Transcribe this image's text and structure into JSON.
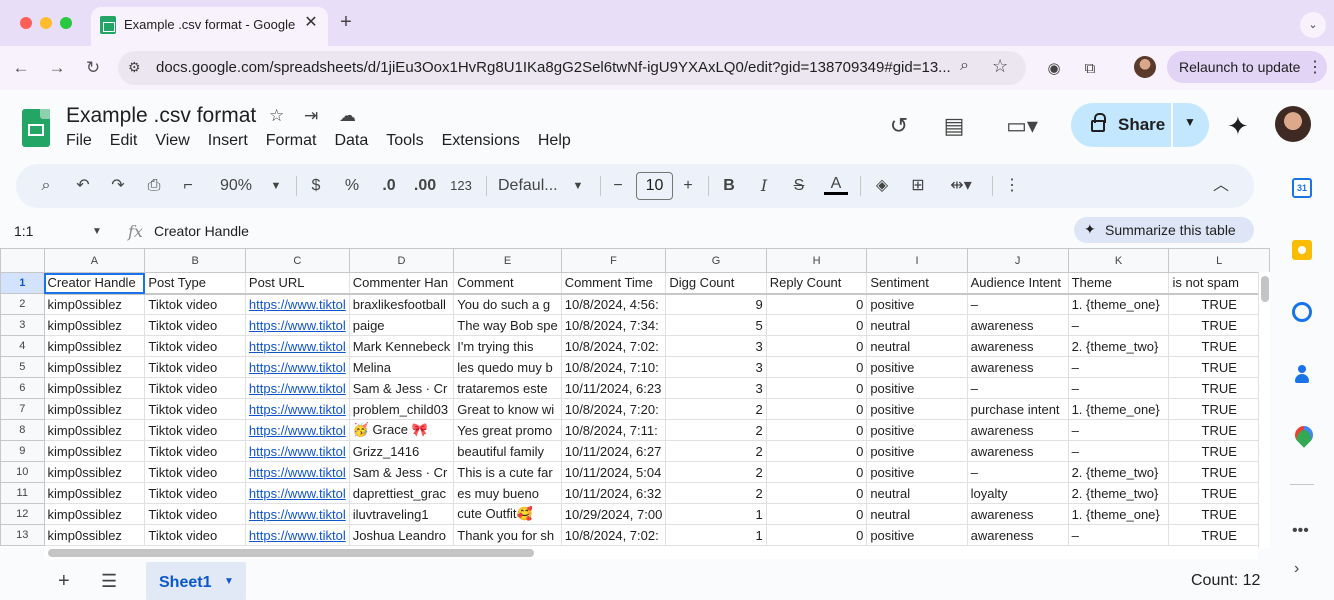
{
  "browser": {
    "tab_title": "Example .csv format - Google",
    "url": "docs.google.com/spreadsheets/d/1jiEu3Oox1HvRg8U1IKa8gG2Sel6twNf-igU9YXAxLQ0/edit?gid=138709349#gid=13...",
    "relaunch_label": "Relaunch to update"
  },
  "doc": {
    "title": "Example .csv format",
    "menu": [
      "File",
      "Edit",
      "View",
      "Insert",
      "Format",
      "Data",
      "Tools",
      "Extensions",
      "Help"
    ],
    "share_label": "Share"
  },
  "toolbar": {
    "zoom": "90%",
    "currency": "$",
    "percent": "%",
    "dec_decrease": ".0",
    "dec_increase": ".00",
    "number_format": "123",
    "font": "Defaul...",
    "font_size": "10"
  },
  "formula_bar": {
    "cell_ref": "1:1",
    "content": "Creator Handle",
    "summarize_label": "Summarize this table"
  },
  "grid": {
    "columns": [
      "A",
      "B",
      "C",
      "D",
      "E",
      "F",
      "G",
      "H",
      "I",
      "J",
      "K",
      "L"
    ],
    "row_numbers": [
      "1",
      "2",
      "3",
      "4",
      "5",
      "6",
      "7",
      "8",
      "9",
      "10",
      "11",
      "12",
      "13"
    ],
    "header": [
      "Creator Handle",
      "Post Type",
      "Post URL",
      "Commenter Han",
      "Comment",
      "Comment Time",
      "Digg Count",
      "Reply Count",
      "Sentiment",
      "Audience Intent",
      "Theme",
      "is not spam"
    ],
    "rows": [
      [
        "kimp0ssiblez",
        "Tiktok video",
        "https://www.tiktol",
        "braxlikesfootball",
        "You do such a g",
        "10/8/2024, 4:56:",
        "9",
        "0",
        "positive",
        "–",
        "1. {theme_one}",
        "TRUE"
      ],
      [
        "kimp0ssiblez",
        "Tiktok video",
        "https://www.tiktol",
        "paige",
        "The way Bob spe",
        "10/8/2024, 7:34:",
        "5",
        "0",
        "neutral",
        "awareness",
        "–",
        "TRUE"
      ],
      [
        "kimp0ssiblez",
        "Tiktok video",
        "https://www.tiktol",
        "Mark Kennebeck",
        "I'm trying this",
        "10/8/2024, 7:02:",
        "3",
        "0",
        "neutral",
        "awareness",
        "2. {theme_two}",
        "TRUE"
      ],
      [
        "kimp0ssiblez",
        "Tiktok video",
        "https://www.tiktol",
        "Melina",
        "les quedo muy b",
        "10/8/2024, 7:10:",
        "3",
        "0",
        "positive",
        "awareness",
        "–",
        "TRUE"
      ],
      [
        "kimp0ssiblez",
        "Tiktok video",
        "https://www.tiktol",
        "Sam & Jess · Cr",
        "trataremos este",
        "10/11/2024, 6:23",
        "3",
        "0",
        "positive",
        "–",
        "–",
        "TRUE"
      ],
      [
        "kimp0ssiblez",
        "Tiktok video",
        "https://www.tiktol",
        "problem_child03",
        "Great to know wi",
        "10/8/2024, 7:20:",
        "2",
        "0",
        "positive",
        "purchase intent",
        "1. {theme_one}",
        "TRUE"
      ],
      [
        "kimp0ssiblez",
        "Tiktok video",
        "https://www.tiktol",
        "🥳 Grace 🎀",
        "Yes great promo",
        "10/8/2024, 7:11:",
        "2",
        "0",
        "positive",
        "awareness",
        "–",
        "TRUE"
      ],
      [
        "kimp0ssiblez",
        "Tiktok video",
        "https://www.tiktol",
        "Grizz_1416",
        "beautiful family",
        "10/11/2024, 6:27",
        "2",
        "0",
        "positive",
        "awareness",
        "–",
        "TRUE"
      ],
      [
        "kimp0ssiblez",
        "Tiktok video",
        "https://www.tiktol",
        "Sam & Jess · Cr",
        "This is a cute far",
        "10/11/2024, 5:04",
        "2",
        "0",
        "positive",
        "–",
        "2. {theme_two}",
        "TRUE"
      ],
      [
        "kimp0ssiblez",
        "Tiktok video",
        "https://www.tiktol",
        "daprettiest_grac",
        "es muy bueno",
        "10/11/2024, 6:32",
        "2",
        "0",
        "neutral",
        "loyalty",
        "2. {theme_two}",
        "TRUE"
      ],
      [
        "kimp0ssiblez",
        "Tiktok video",
        "https://www.tiktol",
        "iluvtraveling1",
        "cute Outfit🥰",
        "10/29/2024, 7:00",
        "1",
        "0",
        "neutral",
        "awareness",
        "1. {theme_one}",
        "TRUE"
      ],
      [
        "kimp0ssiblez",
        "Tiktok video",
        "https://www.tiktol",
        "Joshua Leandro",
        "Thank you for sh",
        "10/8/2024, 7:02:",
        "1",
        "0",
        "positive",
        "awareness",
        "–",
        "TRUE"
      ]
    ]
  },
  "bottom": {
    "sheet_name": "Sheet1",
    "count": "Count: 12"
  },
  "side_panel": {
    "calendar_day": "31"
  },
  "colors": {
    "accent": "#1a73e8",
    "share_bg": "#c2e7ff",
    "sheets_green": "#23a566",
    "tab_strip": "#e8def7"
  }
}
